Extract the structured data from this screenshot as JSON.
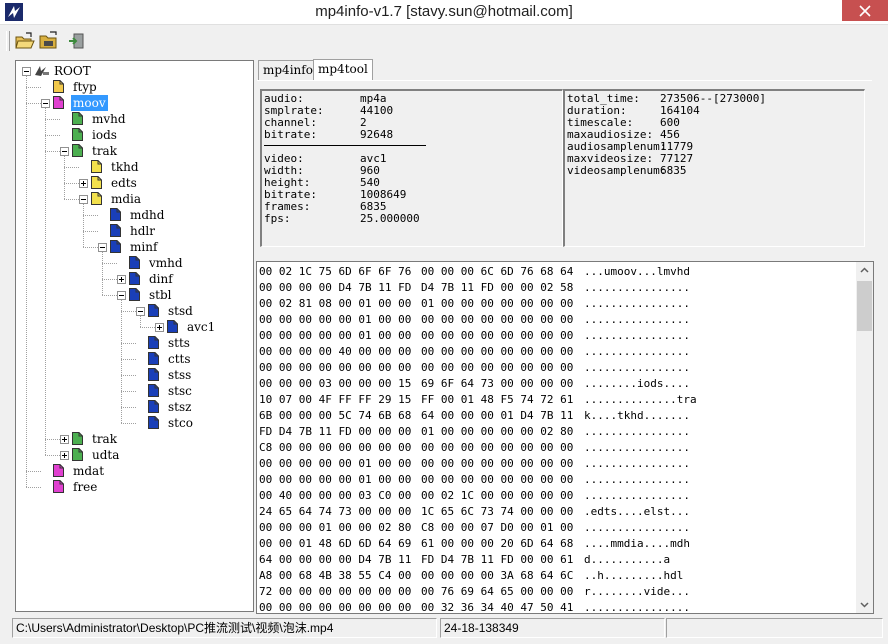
{
  "window": {
    "title": "mp4info-v1.7 [stavy.sun@hotmail.com]"
  },
  "toolbar": {
    "buttons": [
      "open-icon",
      "open-folder-icon",
      "exit-icon"
    ]
  },
  "tree": [
    {
      "label": "ROOT",
      "depth": 0,
      "color": "root",
      "expander": "minus"
    },
    {
      "label": "ftyp",
      "depth": 1,
      "color": "#f2c94c",
      "expander": "none"
    },
    {
      "label": "moov",
      "depth": 1,
      "color": "#e040d0",
      "expander": "minus",
      "selected": true
    },
    {
      "label": "mvhd",
      "depth": 2,
      "color": "#4caf50",
      "expander": "none"
    },
    {
      "label": "iods",
      "depth": 2,
      "color": "#4caf50",
      "expander": "none"
    },
    {
      "label": "trak",
      "depth": 2,
      "color": "#4caf50",
      "expander": "minus"
    },
    {
      "label": "tkhd",
      "depth": 3,
      "color": "#f2e04c",
      "expander": "none"
    },
    {
      "label": "edts",
      "depth": 3,
      "color": "#f2e04c",
      "expander": "plus"
    },
    {
      "label": "mdia",
      "depth": 3,
      "color": "#f2e04c",
      "expander": "minus"
    },
    {
      "label": "mdhd",
      "depth": 4,
      "color": "#1a3fb8",
      "expander": "none"
    },
    {
      "label": "hdlr",
      "depth": 4,
      "color": "#1a3fb8",
      "expander": "none"
    },
    {
      "label": "minf",
      "depth": 4,
      "color": "#1a3fb8",
      "expander": "minus"
    },
    {
      "label": "vmhd",
      "depth": 5,
      "color": "#1a3fb8",
      "expander": "none"
    },
    {
      "label": "dinf",
      "depth": 5,
      "color": "#1a3fb8",
      "expander": "plus"
    },
    {
      "label": "stbl",
      "depth": 5,
      "color": "#1a3fb8",
      "expander": "minus"
    },
    {
      "label": "stsd",
      "depth": 6,
      "color": "#1a3fb8",
      "expander": "minus"
    },
    {
      "label": "avc1",
      "depth": 7,
      "color": "#1a3fb8",
      "expander": "plus"
    },
    {
      "label": "stts",
      "depth": 6,
      "color": "#1a3fb8",
      "expander": "none"
    },
    {
      "label": "ctts",
      "depth": 6,
      "color": "#1a3fb8",
      "expander": "none"
    },
    {
      "label": "stss",
      "depth": 6,
      "color": "#1a3fb8",
      "expander": "none"
    },
    {
      "label": "stsc",
      "depth": 6,
      "color": "#1a3fb8",
      "expander": "none"
    },
    {
      "label": "stsz",
      "depth": 6,
      "color": "#1a3fb8",
      "expander": "none"
    },
    {
      "label": "stco",
      "depth": 6,
      "color": "#1a3fb8",
      "expander": "none"
    },
    {
      "label": "trak",
      "depth": 2,
      "color": "#4caf50",
      "expander": "plus"
    },
    {
      "label": "udta",
      "depth": 2,
      "color": "#4caf50",
      "expander": "plus"
    },
    {
      "label": "mdat",
      "depth": 1,
      "color": "#e040d0",
      "expander": "none"
    },
    {
      "label": "free",
      "depth": 1,
      "color": "#e040d0",
      "expander": "none"
    }
  ],
  "tabs": [
    {
      "label": "mp4info",
      "active": false
    },
    {
      "label": "mp4tool",
      "active": true
    }
  ],
  "info_left": {
    "audio": [
      {
        "k": "audio:",
        "v": "mp4a"
      },
      {
        "k": "smplrate:",
        "v": "44100"
      },
      {
        "k": "channel:",
        "v": "2"
      },
      {
        "k": "bitrate:",
        "v": "92648"
      }
    ],
    "video": [
      {
        "k": "video:",
        "v": "avc1"
      },
      {
        "k": "width:",
        "v": "960"
      },
      {
        "k": "height:",
        "v": "540"
      },
      {
        "k": "bitrate:",
        "v": "1008649"
      },
      {
        "k": "frames:",
        "v": "6835"
      },
      {
        "k": "fps:",
        "v": "25.000000"
      }
    ]
  },
  "info_right": [
    {
      "k": "total_time:",
      "v": "273506--[273000]"
    },
    {
      "k": "duration:",
      "v": "164104"
    },
    {
      "k": "timescale:",
      "v": "600"
    },
    {
      "k": "maxaudiosize:",
      "v": "456"
    },
    {
      "k": "audiosamplenum:",
      "v": "11779"
    },
    {
      "k": "maxvideosize:",
      "v": "77127"
    },
    {
      "k": "videosamplenum:",
      "v": "6835"
    }
  ],
  "hex_rows": [
    {
      "a": "00 02 1C 75 6D 6F 6F 76",
      "b": "00 00 00 6C 6D 76 68 64",
      "c": "...umoov...lmvhd"
    },
    {
      "a": "00 00 00 00 D4 7B 11 FD",
      "b": "D4 7B 11 FD 00 00 02 58",
      "c": "................"
    },
    {
      "a": "00 02 81 08 00 01 00 00",
      "b": "01 00 00 00 00 00 00 00",
      "c": "................"
    },
    {
      "a": "00 00 00 00 00 01 00 00",
      "b": "00 00 00 00 00 00 00 00",
      "c": "................"
    },
    {
      "a": "00 00 00 00 00 01 00 00",
      "b": "00 00 00 00 00 00 00 00",
      "c": "................"
    },
    {
      "a": "00 00 00 00 40 00 00 00",
      "b": "00 00 00 00 00 00 00 00",
      "c": "................"
    },
    {
      "a": "00 00 00 00 00 00 00 00",
      "b": "00 00 00 00 00 00 00 00",
      "c": "................"
    },
    {
      "a": "00 00 00 03 00 00 00 15",
      "b": "69 6F 64 73 00 00 00 00",
      "c": "........iods...."
    },
    {
      "a": "10 07 00 4F FF FF 29 15",
      "b": "FF 00 01 48 F5 74 72 61",
      "c": "..............tra"
    },
    {
      "a": "6B 00 00 00 5C 74 6B 68",
      "b": "64 00 00 00 01 D4 7B 11",
      "c": "k....tkhd......."
    },
    {
      "a": "FD D4 7B 11 FD 00 00 00",
      "b": "01 00 00 00 00 00 02 80",
      "c": "................"
    },
    {
      "a": "C8 00 00 00 00 00 00 00",
      "b": "00 00 00 00 00 00 00 00",
      "c": "................"
    },
    {
      "a": "00 00 00 00 00 01 00 00",
      "b": "00 00 00 00 00 00 00 00",
      "c": "................"
    },
    {
      "a": "00 00 00 00 00 01 00 00",
      "b": "00 00 00 00 00 00 00 00",
      "c": "................"
    },
    {
      "a": "00 40 00 00 00 03 C0 00",
      "b": "00 02 1C 00 00 00 00 00",
      "c": "................"
    },
    {
      "a": "24 65 64 74 73 00 00 00",
      "b": "1C 65 6C 73 74 00 00 00",
      "c": ".edts....elst..."
    },
    {
      "a": "00 00 00 01 00 00 02 80",
      "b": "C8 00 00 07 D0 00 01 00",
      "c": "................"
    },
    {
      "a": "00 00 01 48 6D 6D 64 69",
      "b": "61 00 00 00 20 6D 64 68",
      "c": "....mmdia....mdh"
    },
    {
      "a": "64 00 00 00 00 D4 7B 11",
      "b": "FD D4 7B 11 FD 00 00 61",
      "c": "d...........a"
    },
    {
      "a": "A8 00 68 4B 38 55 C4 00",
      "b": "00 00 00 00 3A 68 64 6C",
      "c": "..h.........hdl"
    },
    {
      "a": "72 00 00 00 00 00 00 00",
      "b": "00 76 69 64 65 00 00 00",
      "c": "r........vide..."
    },
    {
      "a": "00 00 00 00 00 00 00 00",
      "b": "00 32 36 34 40 47 50 41",
      "c": "................"
    }
  ],
  "status": {
    "path": "C:\\Users\\Administrator\\Desktop\\PC推流测试\\视频\\泡沫.mp4",
    "time": "24-18-138349",
    "extra": ""
  }
}
